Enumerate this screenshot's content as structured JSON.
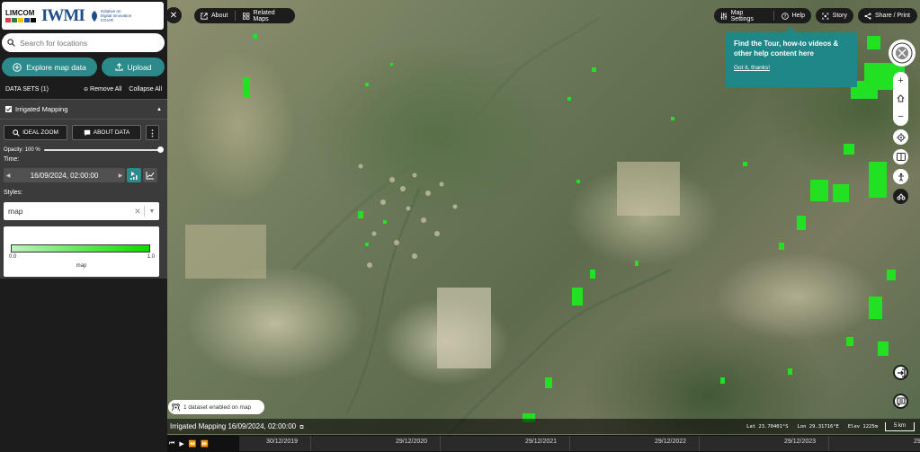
{
  "branding": {
    "limcom": "LIMCOM",
    "iwmi": "IWMI",
    "cgiar_line1": "Initiative on",
    "cgiar_line2": "Digital Innovation",
    "cgiar_name": "CGIAR"
  },
  "search": {
    "placeholder": "Search for locations"
  },
  "sidebar": {
    "explore_label": "Explore map data",
    "upload_label": "Upload",
    "datasets_title": "DATA SETS (1)",
    "remove_all": "Remove All",
    "collapse_all": "Collapse All"
  },
  "dataset": {
    "name": "Irrigated Mapping",
    "ideal_zoom": "IDEAL ZOOM",
    "about_data": "ABOUT DATA",
    "opacity_label": "Opacity: 100 %",
    "opacity": 1.0,
    "time_label": "Time:",
    "time_value": "16/09/2024, 02:00:00",
    "styles_label": "Styles:",
    "style_value": "map",
    "legend_min": "0.0",
    "legend_max": "1.0",
    "legend_title": "map",
    "legend_colors": [
      "#bff2c0",
      "#12d600"
    ]
  },
  "topbar": {
    "about": "About",
    "related_maps": "Related Maps",
    "map_settings": "Map Settings",
    "help": "Help",
    "story": "Story",
    "share": "Share / Print"
  },
  "tooltip": {
    "message": "Find the Tour, how-to videos & other help content here",
    "link": "Got it, thanks!"
  },
  "status": {
    "enabled": "1 dataset enabled on map"
  },
  "info": {
    "dataset_time": "Irrigated Mapping 16/09/2024, 02:00:00",
    "lat": "Lat  23.70401°S",
    "lon": "Lon  29.31716°E",
    "elev": "Elev  1225m",
    "scale": "5 km"
  },
  "timeline": {
    "labels": [
      "30/12/2019",
      "29/12/2020",
      "29/12/2021",
      "29/12/2022",
      "29/12/2023",
      "29/12/20"
    ]
  },
  "colors": {
    "accent": "#2c8a8a",
    "irrigation": "#22e022"
  }
}
